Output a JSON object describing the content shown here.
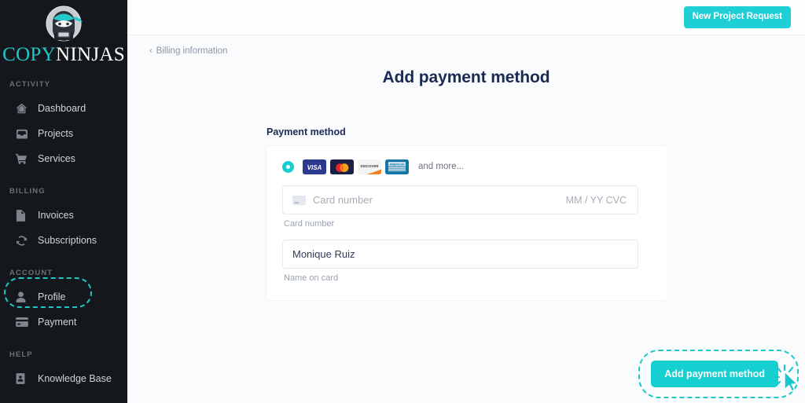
{
  "brand": {
    "logo_icon": "ninja-mascot-icon",
    "wordmark_first": "COPY",
    "wordmark_second": "NINJAS",
    "accent_color": "#1fc8c8"
  },
  "sidebar": {
    "sections": [
      {
        "label": "ACTIVITY",
        "items": [
          {
            "label": "Dashboard",
            "icon": "home-icon"
          },
          {
            "label": "Projects",
            "icon": "inbox-icon"
          },
          {
            "label": "Services",
            "icon": "cart-icon"
          }
        ]
      },
      {
        "label": "BILLING",
        "items": [
          {
            "label": "Invoices",
            "icon": "document-icon"
          },
          {
            "label": "Subscriptions",
            "icon": "refresh-icon"
          }
        ]
      },
      {
        "label": "ACCOUNT",
        "items": [
          {
            "label": "Profile",
            "icon": "user-icon"
          },
          {
            "label": "Payment",
            "icon": "credit-card-icon",
            "highlighted": true
          }
        ]
      },
      {
        "label": "HELP",
        "items": [
          {
            "label": "Knowledge Base",
            "icon": "book-icon"
          }
        ]
      }
    ]
  },
  "header": {
    "new_project_label": "New Project Request"
  },
  "breadcrumb": {
    "chevron": "‹",
    "label": "Billing information"
  },
  "page": {
    "title": "Add payment method"
  },
  "payment_form": {
    "heading": "Payment method",
    "radio_selected": true,
    "brands": [
      "visa",
      "mastercard",
      "discover",
      "amex"
    ],
    "and_more_label": "and more...",
    "card_number": {
      "icon": "credit-card-icon",
      "placeholder": "Card number",
      "value": "",
      "expiry_cvc_placeholder": "MM / YY  CVC",
      "hint": "Card number"
    },
    "name_on_card": {
      "placeholder": "Name on card",
      "value": "Monique Ruiz",
      "hint": "Name on card"
    }
  },
  "actions": {
    "add_payment_method_label": "Add payment method",
    "highlighted": true,
    "cursor": "click-cursor-icon"
  },
  "colors": {
    "teal": "#15cfd0",
    "sidebar_bg": "#14181d",
    "page_bg": "#fafbfc",
    "title_navy": "#1a2b53"
  }
}
